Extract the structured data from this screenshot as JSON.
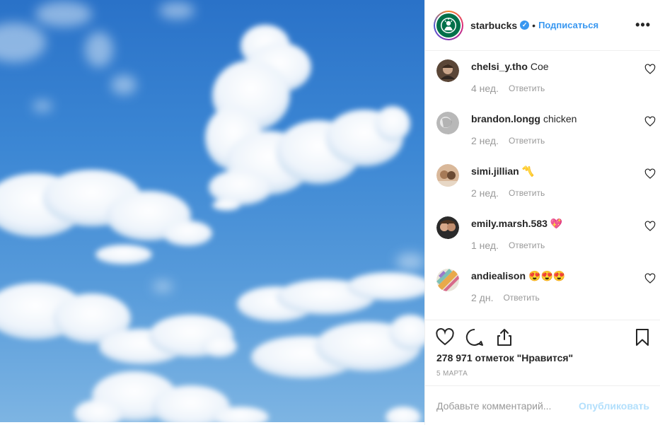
{
  "header": {
    "username": "starbucks",
    "verified_icon": "verified-badge-icon",
    "separator": "•",
    "follow_label": "Подписаться",
    "more_icon": "more-options-icon",
    "more_glyph": "•••"
  },
  "comments": [
    {
      "user": "chelsi_y.tho",
      "text": "Coe",
      "time": "4 нед.",
      "reply": "Ответить"
    },
    {
      "user": "brandon.longg",
      "text": "chicken",
      "time": "2 нед.",
      "reply": "Ответить"
    },
    {
      "user": "simi.jillian",
      "text": "〽️",
      "time": "2 нед.",
      "reply": "Ответить"
    },
    {
      "user": "emily.marsh.583",
      "text": "💖",
      "time": "1 нед.",
      "reply": "Ответить"
    },
    {
      "user": "andiealison",
      "text": "😍😍😍",
      "time": "2 дн.",
      "reply": "Ответить"
    }
  ],
  "actions": {
    "likes": "278 971 отметок \"Нравится\"",
    "date": "5 МАРТА"
  },
  "add_comment": {
    "placeholder": "Добавьте комментарий...",
    "publish_label": "Опубликовать"
  },
  "colors": {
    "accent": "#3897f0",
    "starbucks_green": "#00704a",
    "publish_disabled": "#b2dffc"
  }
}
